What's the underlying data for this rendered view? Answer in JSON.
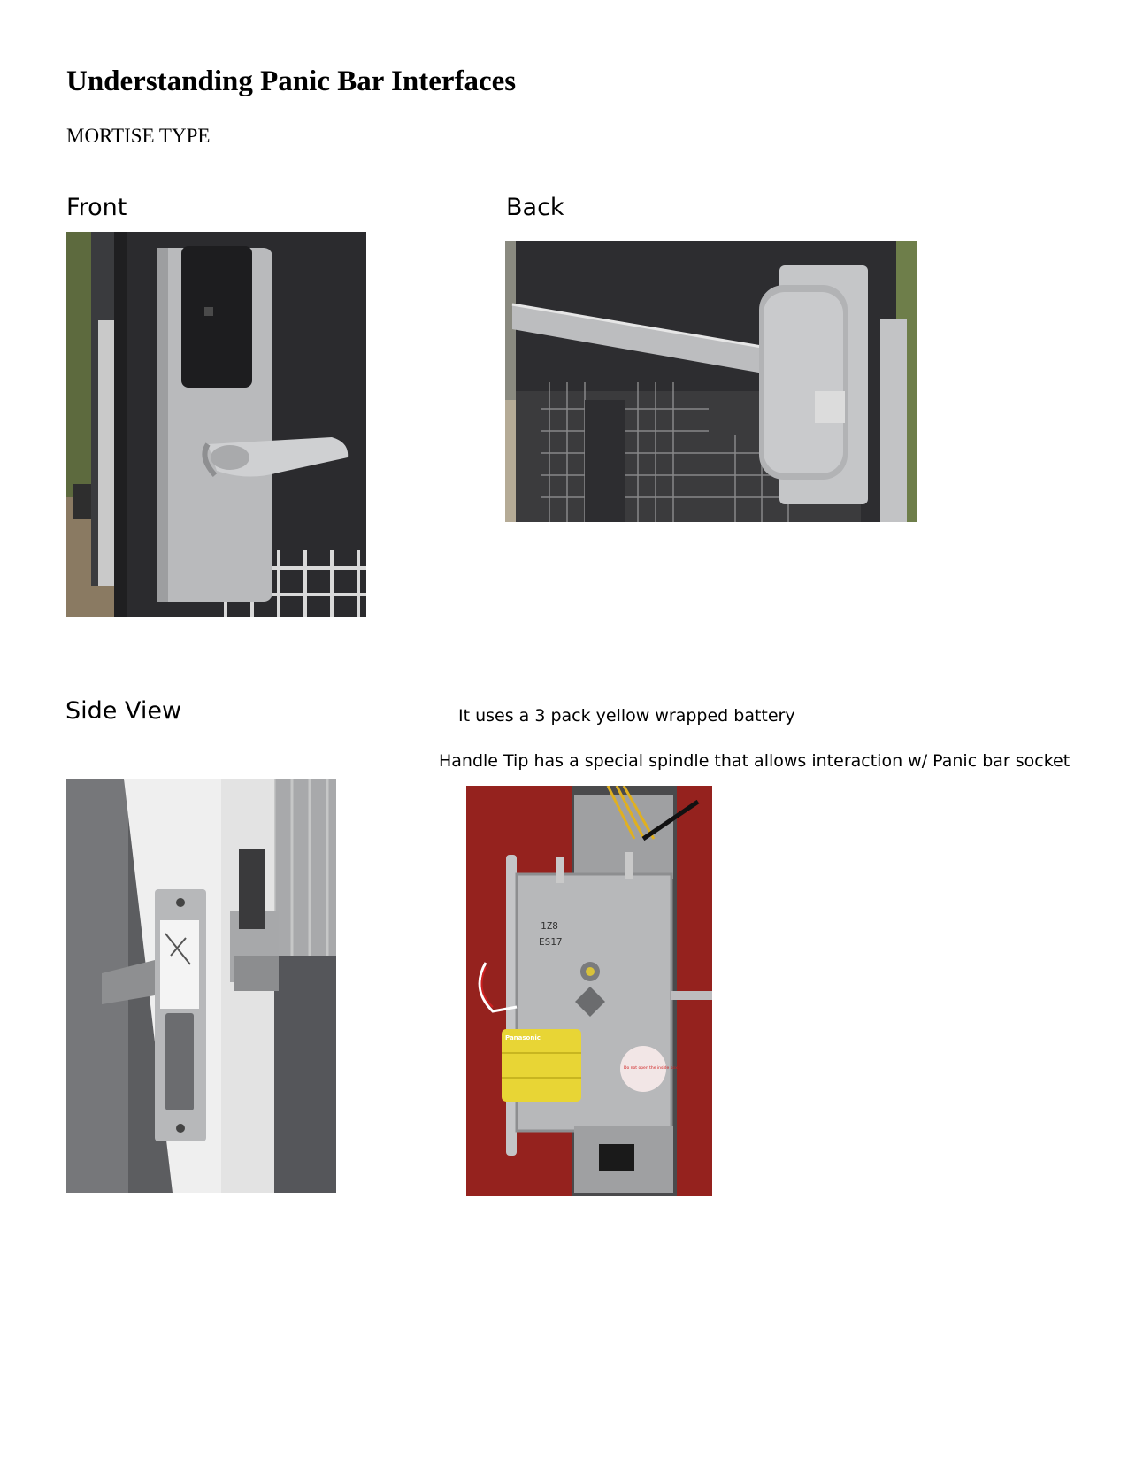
{
  "document": {
    "title": "Understanding Panic Bar Interfaces",
    "subtitle": "MORTISE TYPE"
  },
  "sections": {
    "front": {
      "label": "Front"
    },
    "back": {
      "label": "Back"
    },
    "side_view": {
      "label": "Side View"
    }
  },
  "notes": {
    "battery": "It uses a 3 pack yellow wrapped battery",
    "handle_tip": "Handle Tip has a special spindle that allows interaction w/ Panic bar socket"
  },
  "photo_markings": {
    "lock_code_1": "1Z8",
    "lock_code_2": "ES17",
    "battery_brand": "Panasonic",
    "warning_sticker": "Do not open the inside box"
  },
  "colors": {
    "door_dark": "#2b2b2e",
    "steel": "#b9babc",
    "battery_yellow": "#e8d535",
    "tabletop_red": "#8f1f1c"
  }
}
